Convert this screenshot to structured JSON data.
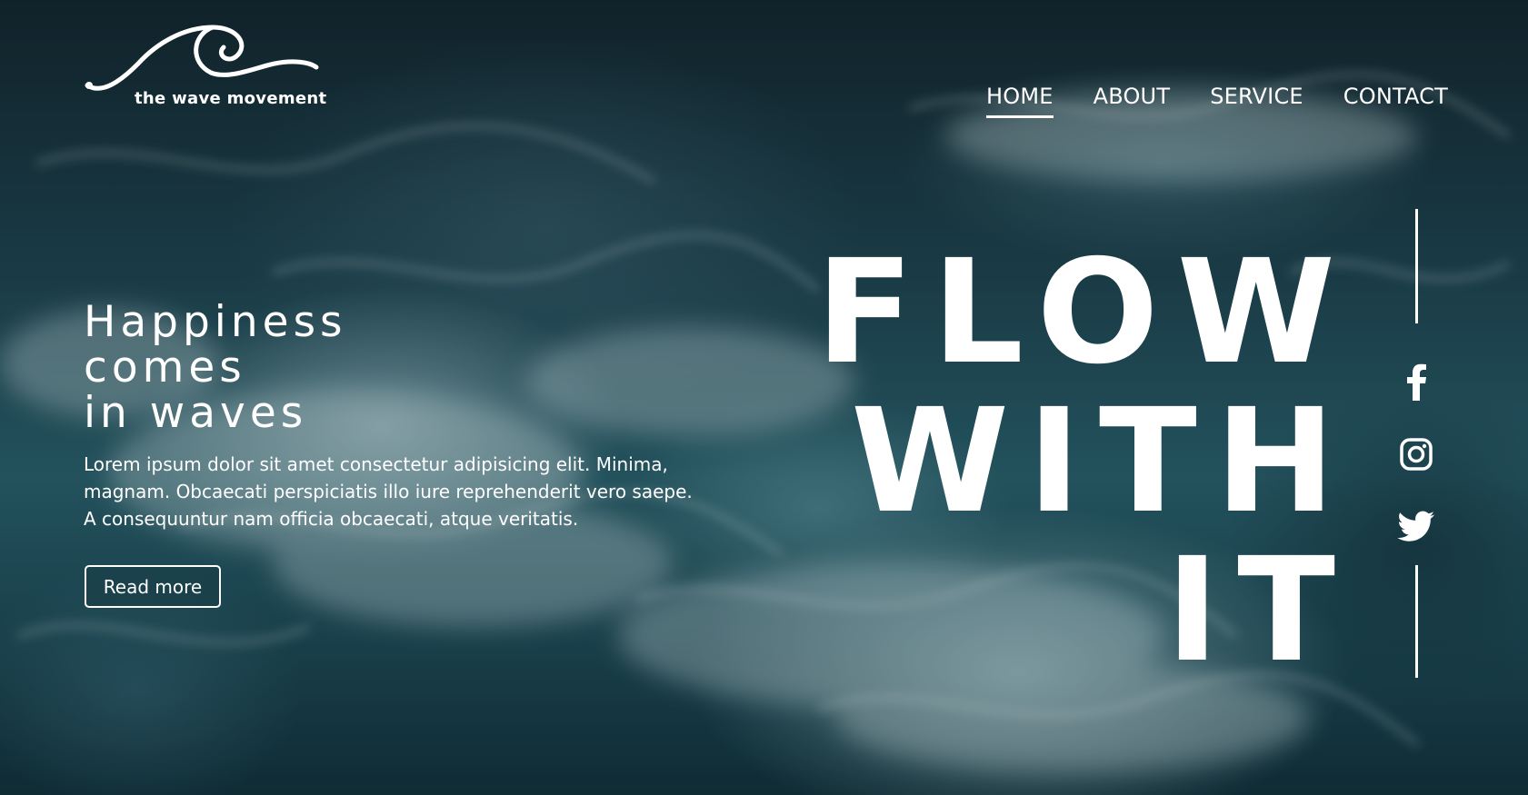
{
  "brand": {
    "name": "the wave movement"
  },
  "nav": {
    "items": [
      {
        "label": "HOME",
        "active": true
      },
      {
        "label": "ABOUT",
        "active": false
      },
      {
        "label": "SERVICE",
        "active": false
      },
      {
        "label": "CONTACT",
        "active": false
      }
    ]
  },
  "hero": {
    "title_lines": [
      "Happiness",
      "comes",
      "in waves"
    ],
    "description_lines": [
      "Lorem ipsum dolor sit amet consectetur adipisicing elit. Minima,",
      "magnam. Obcaecati perspiciatis illo iure reprehenderit vero saepe.",
      "A consequuntur nam officia obcaecati, atque veritatis."
    ],
    "button_label": "Read more"
  },
  "headline": {
    "lines": [
      "FLOW",
      "WITH",
      "IT"
    ]
  },
  "social": {
    "icons": [
      "facebook-icon",
      "instagram-icon",
      "twitter-icon"
    ]
  },
  "colors": {
    "text": "#ffffff",
    "background": "#1f4450"
  }
}
